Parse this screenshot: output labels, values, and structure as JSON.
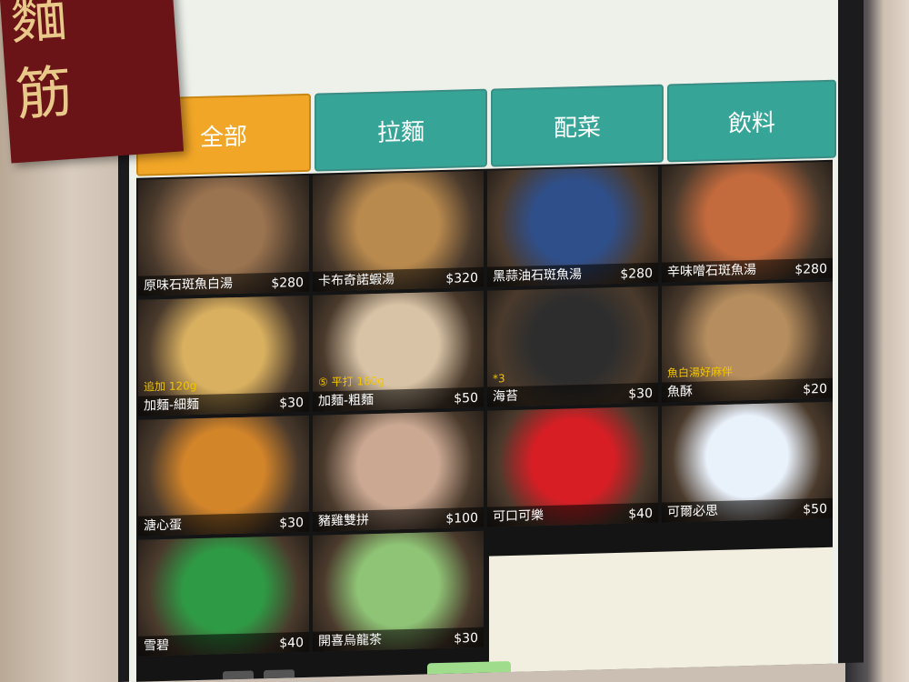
{
  "banner": {
    "text": "麵\n筋"
  },
  "tabs": [
    {
      "label": "全部",
      "active": true
    },
    {
      "label": "拉麵",
      "active": false
    },
    {
      "label": "配菜",
      "active": false
    },
    {
      "label": "飲料",
      "active": false
    }
  ],
  "items": [
    {
      "name": "原味石斑魚白湯",
      "price": "$280",
      "note": "",
      "color": "#9a7350"
    },
    {
      "name": "卡布奇諾蝦湯",
      "price": "$320",
      "note": "",
      "color": "#b98a4e"
    },
    {
      "name": "黑蒜油石斑魚湯",
      "price": "$280",
      "note": "",
      "color": "#2f4f8a"
    },
    {
      "name": "辛味噌石斑魚湯",
      "price": "$280",
      "note": "",
      "color": "#c46b3d"
    },
    {
      "name": "加麵-細麵",
      "price": "$30",
      "note": "追加 120g",
      "color": "#d9b060"
    },
    {
      "name": "加麵-粗麵",
      "price": "$50",
      "note": "⑤ 平打 160g",
      "color": "#d8c3a6"
    },
    {
      "name": "海苔",
      "price": "$30",
      "note": "*3",
      "color": "#2d2d2d"
    },
    {
      "name": "魚酥",
      "price": "$20",
      "note": "魚白湯好麻伴",
      "color": "#b58d5e"
    },
    {
      "name": "溏心蛋",
      "price": "$30",
      "note": "",
      "color": "#d3852a"
    },
    {
      "name": "豬雞雙拼",
      "price": "$100",
      "note": "",
      "color": "#caa892"
    },
    {
      "name": "可口可樂",
      "price": "$40",
      "note": "",
      "color": "#d81e25"
    },
    {
      "name": "可爾必思",
      "price": "$50",
      "note": "",
      "color": "#e9f1fb"
    },
    {
      "name": "雪碧",
      "price": "$40",
      "note": "",
      "color": "#2f9a45"
    },
    {
      "name": "開喜烏龍茶",
      "price": "$30",
      "note": "",
      "color": "#8fc476"
    }
  ]
}
